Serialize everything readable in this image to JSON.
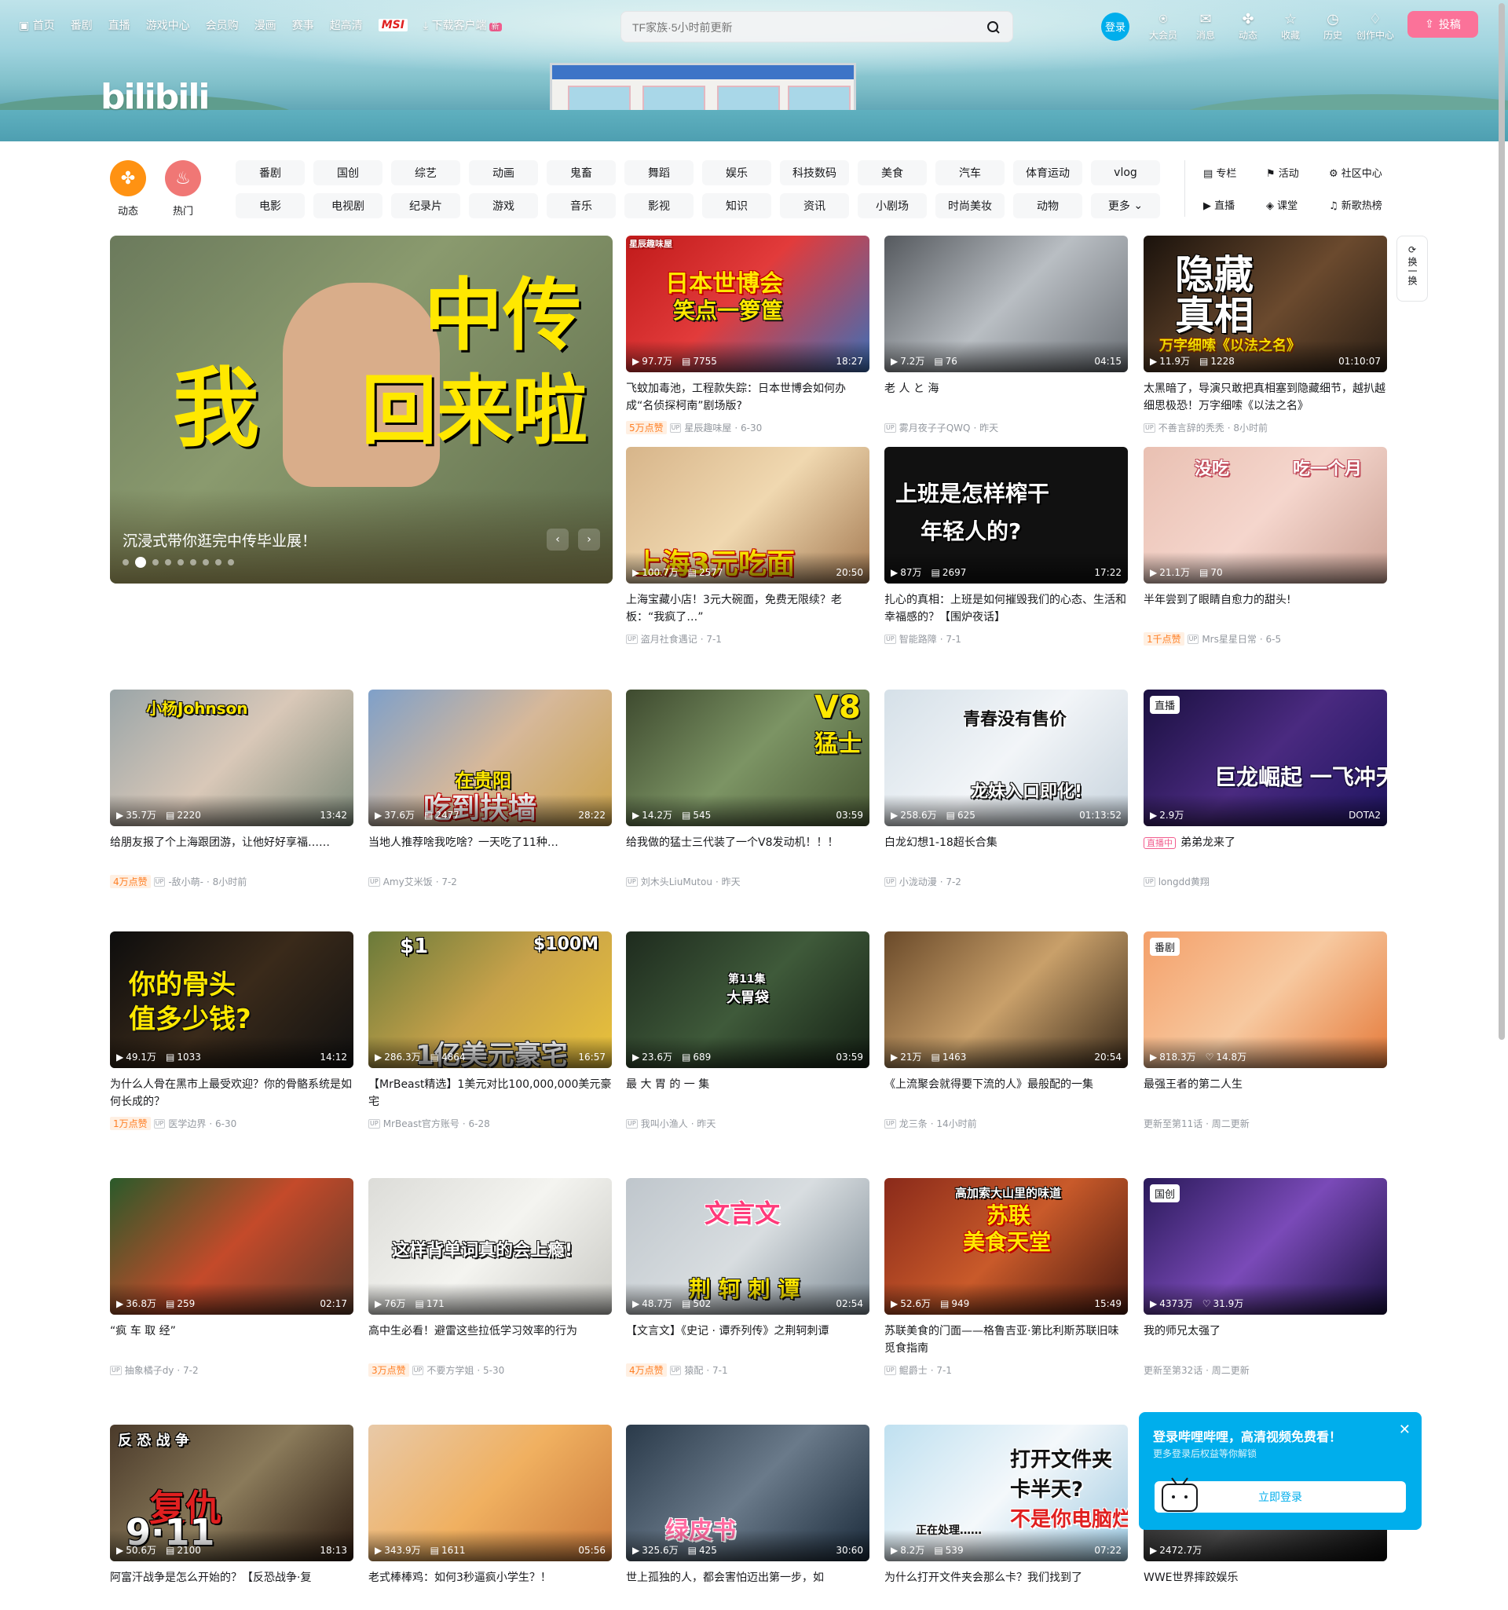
{
  "nav": {
    "left": [
      "首页",
      "番剧",
      "直播",
      "游戏中心",
      "会员购",
      "漫画",
      "赛事",
      "超高清"
    ],
    "msi": "MSI",
    "download": "下载客户端",
    "new_tag": "新",
    "search_placeholder": "TF家族·5小时前更新",
    "login": "登录",
    "right": [
      "大会员",
      "消息",
      "动态",
      "收藏",
      "历史",
      "创作中心"
    ],
    "upload": "投稿"
  },
  "quick": {
    "dynamic": "动态",
    "hot": "热门"
  },
  "channels": [
    "番剧",
    "国创",
    "综艺",
    "动画",
    "鬼畜",
    "舞蹈",
    "娱乐",
    "科技数码",
    "美食",
    "汽车",
    "体育运动",
    "vlog",
    "电影",
    "电视剧",
    "纪录片",
    "游戏",
    "音乐",
    "影视",
    "知识",
    "资讯",
    "小剧场",
    "时尚美妆",
    "动物",
    "更多"
  ],
  "side_links": [
    "专栏",
    "活动",
    "社区中心",
    "直播",
    "课堂",
    "新歌热榜"
  ],
  "refresh": "换一换",
  "carousel": {
    "title": "沉浸式带你逛完中传毕业展！",
    "big1": "中传",
    "big2": "我",
    "big3": "回来啦"
  },
  "cards": [
    {
      "views": "97.7万",
      "danmaku": "7755",
      "dur": "18:27",
      "title": "飞蚊加毒池，工程款失踪：日本世博会如何办成“名侦探柯南”剧场版?",
      "like": "5万点赞",
      "author": "星辰趣味屋",
      "date": "6-30",
      "t1": "日本世博会",
      "t2": "笑点一箩筐",
      "tag": "星辰趣味屋"
    },
    {
      "views": "7.2万",
      "danmaku": "76",
      "dur": "04:15",
      "title": "老 人 と 海",
      "author": "雾月夜子子QWQ",
      "date": "昨天"
    },
    {
      "views": "11.9万",
      "danmaku": "1228",
      "dur": "01:10:07",
      "title": "太黑暗了，导演只敢把真相塞到隐藏细节，越扒越细思极恐！万字细嗦《以法之名》",
      "author": "不善言辞的秃秃",
      "date": "8小时前",
      "t1": "隐藏",
      "t2": "真相",
      "t3": "万字细嗦《以法之名》"
    },
    {
      "views": "100.7万",
      "danmaku": "2577",
      "dur": "20:50",
      "title": "上海宝藏小店！3元大碗面，免费无限续？老板：“我疯了…”",
      "author": "盗月社食遇记",
      "date": "7-1",
      "t1": "上海3元吃面"
    },
    {
      "views": "87万",
      "danmaku": "2697",
      "dur": "17:22",
      "title": "扎心的真相：上班是如何摧毁我们的心态、生活和幸福感的？【围炉夜话】",
      "author": "智能路障",
      "date": "7-1",
      "t1": "上班是怎样榨干",
      "t2": "年轻人的?"
    },
    {
      "views": "21.1万",
      "danmaku": "70",
      "dur": "",
      "title": "半年尝到了眼睛自愈力的甜头!",
      "like": "1千点赞",
      "author": "Mrs星星日常",
      "date": "6-5",
      "t1": "没吃",
      "t2": "吃一个月"
    },
    {
      "views": "35.7万",
      "danmaku": "2220",
      "dur": "13:42",
      "title": "给朋友报了个上海跟团游，让他好好享福……",
      "like": "4万点赞",
      "author": "-敌小萌-",
      "date": "8小时前",
      "t1": "小杨Johnson"
    },
    {
      "views": "37.6万",
      "danmaku": "2477",
      "dur": "28:22",
      "title": "当地人推荐啥我吃啥？一天吃了11种…",
      "author": "Amy艾米饭",
      "date": "7-2",
      "t1": "在贵阳",
      "t2": "吃到扶墙"
    },
    {
      "views": "14.2万",
      "danmaku": "545",
      "dur": "03:59",
      "title": "给我做的猛士三代装了一个V8发动机！！！",
      "author": "刘木头LiuMutou",
      "date": "昨天",
      "t1": "V8",
      "t2": "猛士"
    },
    {
      "views": "258.6万",
      "danmaku": "625",
      "dur": "01:13:52",
      "title": "白龙幻想1-18超长合集",
      "author": "小泷动漫",
      "date": "7-2",
      "t1": "青春没有售价",
      "t2": "龙妹入口即化!"
    },
    {
      "views": "2.9万",
      "danmaku": "",
      "dur": "DOTA2",
      "title": "弟弟龙来了",
      "author": "longdd黄翔",
      "date": "",
      "badge": "直播",
      "live": "直播中",
      "t1": "巨龙崛起 一飞冲天"
    },
    {
      "views": "49.1万",
      "danmaku": "1033",
      "dur": "14:12",
      "title": "为什么人骨在黑市上最受欢迎？你的骨骼系统是如何长成的？",
      "like": "1万点赞",
      "author": "医学边界",
      "date": "6-30",
      "t1": "你的骨头",
      "t2": "值多少钱?"
    },
    {
      "views": "286.3万",
      "danmaku": "4864",
      "dur": "16:57",
      "title": "【MrBeast精选】1美元对比100,000,000美元豪宅",
      "author": "MrBeast官方账号",
      "date": "6-28",
      "t1": "$1",
      "t2": "$100M",
      "t3": "1亿美元豪宅"
    },
    {
      "views": "23.6万",
      "danmaku": "689",
      "dur": "03:59",
      "title": "最 大 胃 的 一 集",
      "author": "我叫小渔人",
      "date": "昨天",
      "t1": "第11集",
      "t2": "大胃袋"
    },
    {
      "views": "21万",
      "danmaku": "1463",
      "dur": "20:54",
      "title": "《上流聚会就得要下流的人》最般配的一集",
      "author": "龙三条",
      "date": "14小时前"
    },
    {
      "views": "818.3万",
      "danmaku": "14.8万",
      "dur": "",
      "title": "最强王者的第二人生",
      "author": "",
      "date": "更新至第11话 · 周二更新",
      "badge": "番剧"
    },
    {
      "views": "36.8万",
      "danmaku": "259",
      "dur": "02:17",
      "title": "“疯 车 取 经”",
      "author": "抽象橘子dy",
      "date": "7-2"
    },
    {
      "views": "76万",
      "danmaku": "171",
      "dur": "",
      "title": "高中生必看！避雷这些拉低学习效率的行为",
      "like": "3万点赞",
      "author": "不要方学姐",
      "date": "5-30",
      "t1": "这样背单词真的会上瘾!"
    },
    {
      "views": "48.7万",
      "danmaku": "502",
      "dur": "02:54",
      "title": "【文言文】《史记 · 谭乔列传》之荆轲刺谭",
      "like": "4万点赞",
      "author": "猿配",
      "date": "7-1",
      "t1": "文言文",
      "t2": "荆 轲 刺 谭"
    },
    {
      "views": "52.6万",
      "danmaku": "949",
      "dur": "15:49",
      "title": "苏联美食的门面——格鲁吉亚·第比利斯苏联旧味觅食指南",
      "author": "鲲爵士",
      "date": "7-1",
      "t1": "高加索大山里的味道",
      "t2": "苏联",
      "t3": "美食天堂"
    },
    {
      "views": "4373万",
      "danmaku": "31.9万",
      "dur": "",
      "title": "我的师兄太强了",
      "author": "",
      "date": "更新至第32话 · 周二更新",
      "badge": "国创"
    },
    {
      "views": "50.6万",
      "danmaku": "2100",
      "dur": "18:13",
      "title": "阿富汗战争是怎么开始的？【反恐战争·复",
      "author": "",
      "date": "",
      "t1": "复仇",
      "t2": "9·11",
      "t3": "反 恐 战 争"
    },
    {
      "views": "343.9万",
      "danmaku": "1611",
      "dur": "05:56",
      "title": "老式棒棒鸡：如何3秒逼疯小学生？！",
      "author": "",
      "date": ""
    },
    {
      "views": "325.6万",
      "danmaku": "425",
      "dur": "30:60",
      "title": "世上孤独的人，都会害怕迈出第一步，如",
      "author": "",
      "date": "",
      "t1": "绿皮书"
    },
    {
      "views": "8.2万",
      "danmaku": "539",
      "dur": "07:22",
      "title": "为什么打开文件夹会那么卡？我们找到了",
      "author": "",
      "date": "",
      "t1": "打开文件夹",
      "t2": "卡半天?",
      "t3": "不是你电脑烂!",
      "t4": "正在处理……"
    },
    {
      "views": "2472.7万",
      "danmaku": "",
      "dur": "",
      "title": "WWE世界摔跤娱乐",
      "author": "",
      "date": ""
    }
  ],
  "popup": {
    "title": "登录哔哩哔哩，高清视频免费看！",
    "sub": "更多登录后权益等你解锁",
    "btn": "立即登录"
  },
  "colors": {
    "accent": "#00aeec",
    "pink": "#fb7299",
    "orange": "#ff7f24"
  }
}
